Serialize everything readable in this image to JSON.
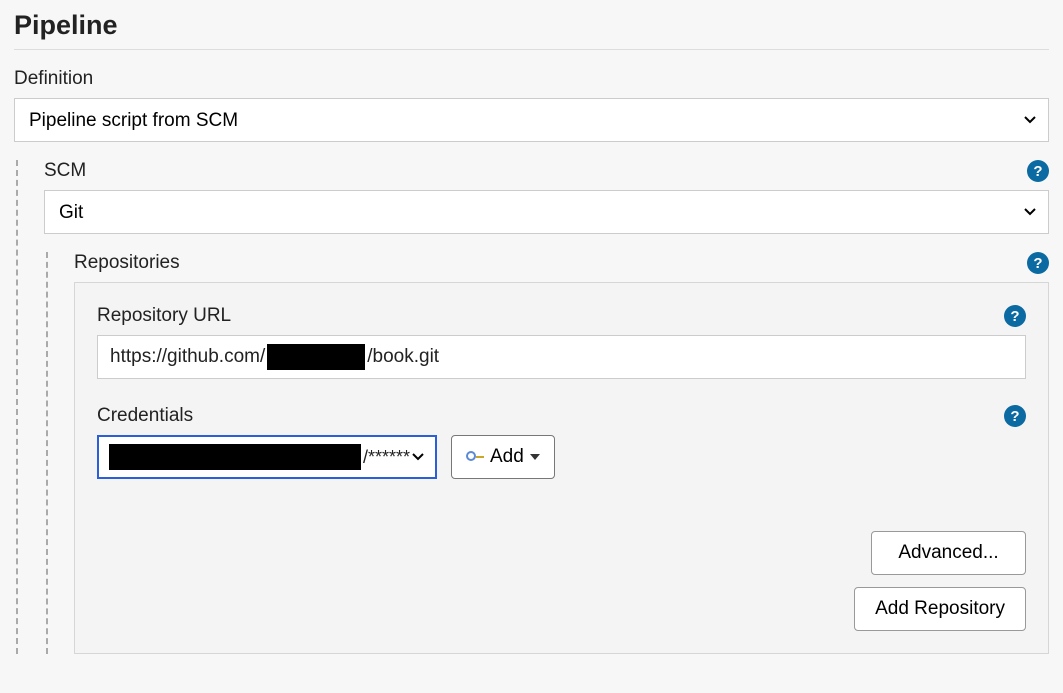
{
  "section": {
    "title": "Pipeline"
  },
  "definition": {
    "label": "Definition",
    "value": "Pipeline script from SCM"
  },
  "scm": {
    "label": "SCM",
    "value": "Git"
  },
  "repositories": {
    "label": "Repositories",
    "url_label": "Repository URL",
    "url_prefix": "https://github.com/",
    "url_suffix": "/book.git",
    "credentials_label": "Credentials",
    "credentials_masked_suffix": "/******",
    "add_label": "Add",
    "advanced_label": "Advanced...",
    "add_repository_label": "Add Repository"
  }
}
